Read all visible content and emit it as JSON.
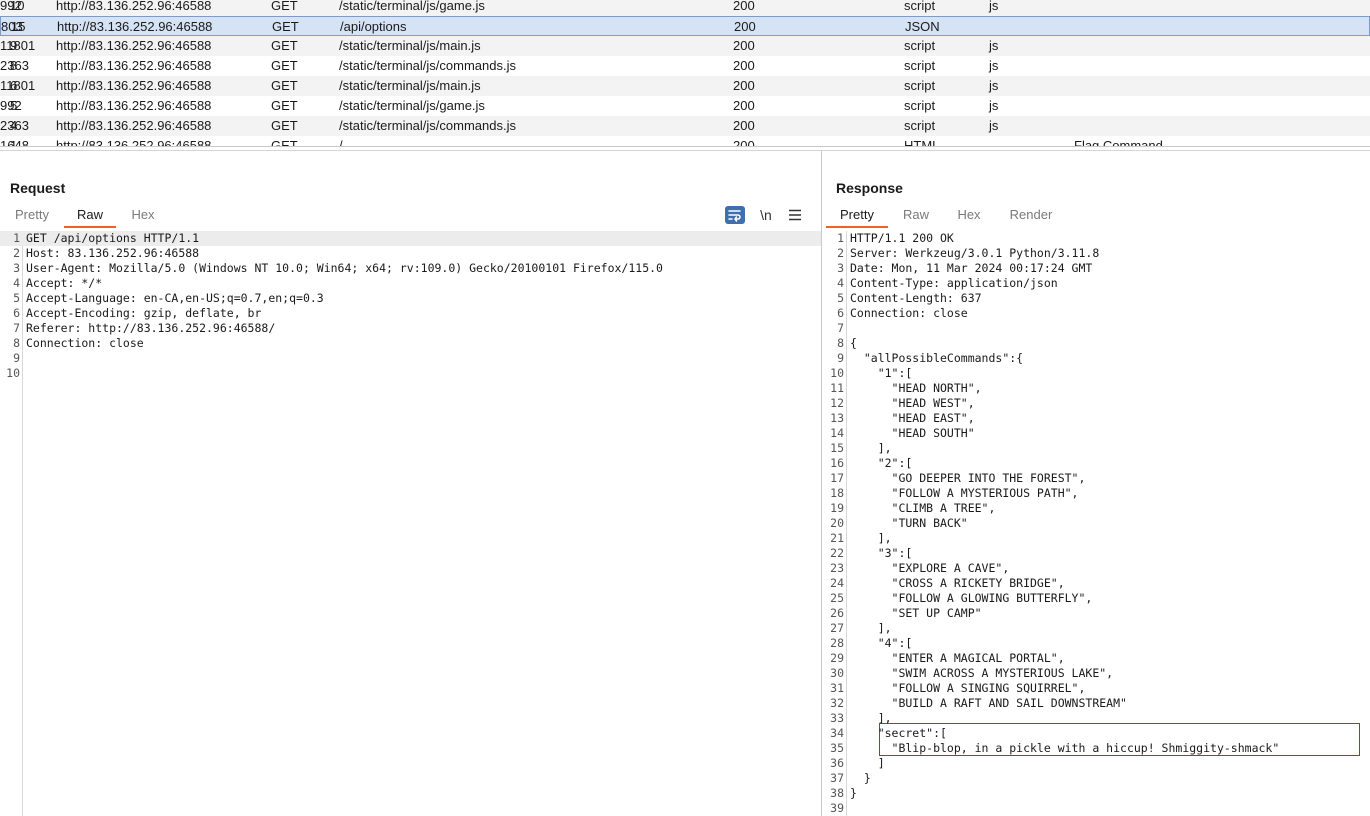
{
  "history": {
    "rows": [
      {
        "num": "10",
        "host": "http://83.136.252.96:46588",
        "method": "GET",
        "url": "/static/terminal/js/game.js",
        "status": "200",
        "length": "992",
        "mime": "script",
        "ext": "js",
        "title": ""
      },
      {
        "num": "15",
        "host": "http://83.136.252.96:46588",
        "method": "GET",
        "url": "/api/options",
        "status": "200",
        "length": "803",
        "mime": "JSON",
        "ext": "",
        "title": ""
      },
      {
        "num": "9",
        "host": "http://83.136.252.96:46588",
        "method": "GET",
        "url": "/static/terminal/js/main.js",
        "status": "200",
        "length": "11801",
        "mime": "script",
        "ext": "js",
        "title": ""
      },
      {
        "num": "8",
        "host": "http://83.136.252.96:46588",
        "method": "GET",
        "url": "/static/terminal/js/commands.js",
        "status": "200",
        "length": "2363",
        "mime": "script",
        "ext": "js",
        "title": ""
      },
      {
        "num": "6",
        "host": "http://83.136.252.96:46588",
        "method": "GET",
        "url": "/static/terminal/js/main.js",
        "status": "200",
        "length": "11801",
        "mime": "script",
        "ext": "js",
        "title": ""
      },
      {
        "num": "5",
        "host": "http://83.136.252.96:46588",
        "method": "GET",
        "url": "/static/terminal/js/game.js",
        "status": "200",
        "length": "992",
        "mime": "script",
        "ext": "js",
        "title": ""
      },
      {
        "num": "4",
        "host": "http://83.136.252.96:46588",
        "method": "GET",
        "url": "/static/terminal/js/commands.js",
        "status": "200",
        "length": "2363",
        "mime": "script",
        "ext": "js",
        "title": ""
      },
      {
        "num": "1",
        "host": "http://83.136.252.96:46588",
        "method": "GET",
        "url": "/",
        "status": "200",
        "length": "1648",
        "mime": "HTML",
        "ext": "",
        "title": "Flag Command"
      }
    ]
  },
  "request": {
    "title": "Request",
    "tabs": [
      "Pretty",
      "Raw",
      "Hex"
    ],
    "active_tab": "Raw",
    "tools": {
      "wrap_icon": "wrap-lines-icon",
      "newline_label": "\\n",
      "menu_icon": "hamburger-menu-icon"
    },
    "lines": [
      "GET /api/options HTTP/1.1",
      "Host: 83.136.252.96:46588",
      "User-Agent: Mozilla/5.0 (Windows NT 10.0; Win64; x64; rv:109.0) Gecko/20100101 Firefox/115.0",
      "Accept: */*",
      "Accept-Language: en-CA,en-US;q=0.7,en;q=0.3",
      "Accept-Encoding: gzip, deflate, br",
      "Referer: http://83.136.252.96:46588/",
      "Connection: close",
      "",
      ""
    ]
  },
  "response": {
    "title": "Response",
    "tabs": [
      "Pretty",
      "Raw",
      "Hex",
      "Render"
    ],
    "active_tab": "Pretty",
    "lines": [
      "HTTP/1.1 200 OK",
      "Server: Werkzeug/3.0.1 Python/3.11.8",
      "Date: Mon, 11 Mar 2024 00:17:24 GMT",
      "Content-Type: application/json",
      "Content-Length: 637",
      "Connection: close",
      "",
      "{",
      "  \"allPossibleCommands\":{",
      "    \"1\":[",
      "      \"HEAD NORTH\",",
      "      \"HEAD WEST\",",
      "      \"HEAD EAST\",",
      "      \"HEAD SOUTH\"",
      "    ],",
      "    \"2\":[",
      "      \"GO DEEPER INTO THE FOREST\",",
      "      \"FOLLOW A MYSTERIOUS PATH\",",
      "      \"CLIMB A TREE\",",
      "      \"TURN BACK\"",
      "    ],",
      "    \"3\":[",
      "      \"EXPLORE A CAVE\",",
      "      \"CROSS A RICKETY BRIDGE\",",
      "      \"FOLLOW A GLOWING BUTTERFLY\",",
      "      \"SET UP CAMP\"",
      "    ],",
      "    \"4\":[",
      "      \"ENTER A MAGICAL PORTAL\",",
      "      \"SWIM ACROSS A MYSTERIOUS LAKE\",",
      "      \"FOLLOW A SINGING SQUIRREL\",",
      "      \"BUILD A RAFT AND SAIL DOWNSTREAM\"",
      "    ],",
      "    \"secret\":[",
      "      \"Blip-blop, in a pickle with a hiccup! Shmiggity-shmack\"",
      "    ]",
      "  }",
      "}",
      ""
    ]
  }
}
